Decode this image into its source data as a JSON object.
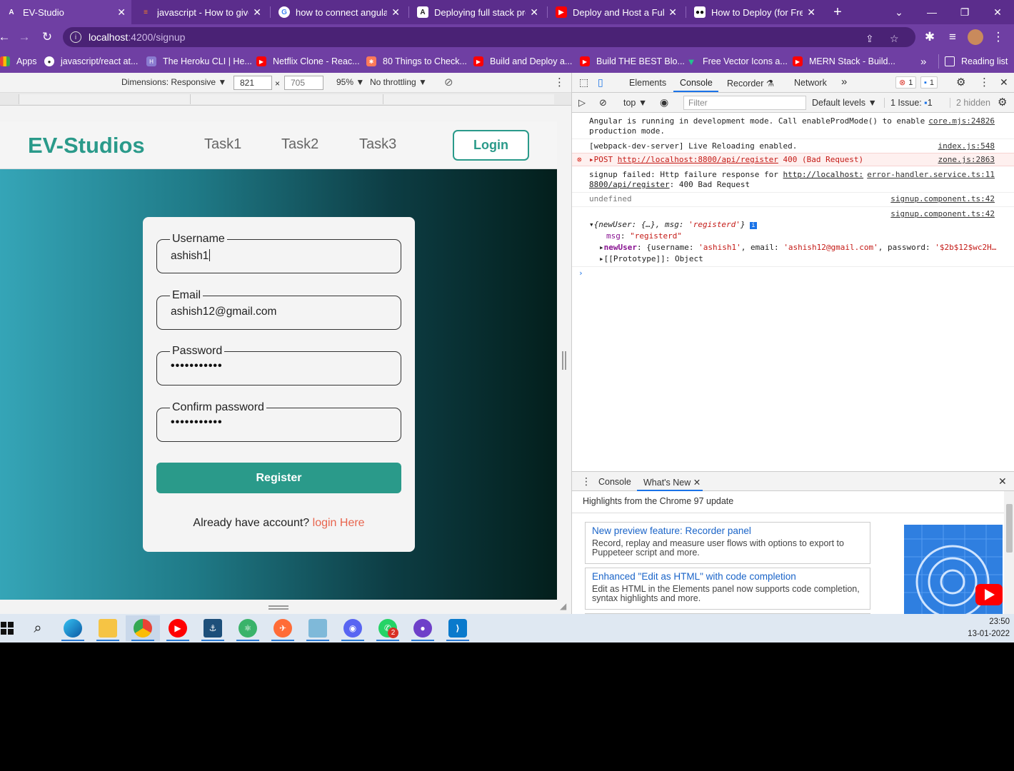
{
  "browser": {
    "tabs": [
      {
        "title": "EV-Studio",
        "icon": "angular-icon",
        "color": "#ffffff"
      },
      {
        "title": "javascript - How to give",
        "icon": "stackoverflow-icon",
        "color": "#f48024"
      },
      {
        "title": "how to connect angular",
        "icon": "google-icon",
        "color": "#4285f4"
      },
      {
        "title": "Deploying full stack proj",
        "icon": "angular-icon",
        "color": "#222222"
      },
      {
        "title": "Deploy and Host a Fullst",
        "icon": "youtube-icon",
        "color": "#ff0000"
      },
      {
        "title": "How to Deploy (for Free",
        "icon": "medium-icon",
        "color": "#000000"
      }
    ],
    "new_tab": "+",
    "url_host": "localhost",
    "url_path": ":4200/signup",
    "bookmarks": [
      {
        "label": "Apps",
        "icon": "apps-icon",
        "color": "#e94235"
      },
      {
        "label": "javascript/react at...",
        "icon": "github-icon",
        "color": "#222222"
      },
      {
        "label": "The Heroku CLI | He...",
        "icon": "heroku-icon",
        "color": "#8a7bd0"
      },
      {
        "label": "Netflix Clone - Reac...",
        "icon": "youtube-icon",
        "color": "#ff0000"
      },
      {
        "label": "80 Things to Check...",
        "icon": "hubspot-icon",
        "color": "#ff7a59"
      },
      {
        "label": "Build and Deploy a...",
        "icon": "youtube-icon",
        "color": "#ff0000"
      },
      {
        "label": "Build THE BEST Blo...",
        "icon": "youtube-icon",
        "color": "#ff0000"
      },
      {
        "label": "Free Vector Icons a...",
        "icon": "vector-icon",
        "color": "#22c38e"
      },
      {
        "label": "MERN Stack - Build...",
        "icon": "youtube-icon",
        "color": "#ff0000"
      }
    ],
    "more_bookmarks": "»",
    "reading_list": "Reading list"
  },
  "device_toolbar": {
    "dimensions_label": "Dimensions: Responsive",
    "width": "821",
    "times": "×",
    "height": "705",
    "zoom": "95%",
    "throttle": "No throttling"
  },
  "app": {
    "brand": "EV-Studios",
    "nav": [
      "Task1",
      "Task2",
      "Task3"
    ],
    "login_button": "Login",
    "form": {
      "username_label": "Username",
      "username_value": "ashish1",
      "email_label": "Email",
      "email_value": "ashish12@gmail.com",
      "password_label": "Password",
      "password_value": "•••••••••••",
      "confirm_label": "Confirm password",
      "confirm_value": "•••••••••••",
      "register_button": "Register",
      "already_text": "Already have account?",
      "login_link": "login Here"
    }
  },
  "devtools": {
    "tabs": [
      "Elements",
      "Console",
      "Recorder",
      "Network"
    ],
    "more": "»",
    "errors_badge": "1",
    "messages_badge": "1",
    "context": "top",
    "filter_placeholder": "Filter",
    "levels": "Default levels",
    "issues": "1 Issue:",
    "issues_count": "1",
    "hidden": "2 hidden",
    "logs": {
      "angular_line1": "Angular is running in development mode. Call enableProdMode() to enable",
      "angular_src": "core.mjs:24826",
      "angular_line2": "production mode.",
      "wds": "[webpack-dev-server] Live Reloading enabled.",
      "wds_src": "index.js:548",
      "err_prefix": "POST",
      "err_url": "http://localhost:8800/api/register",
      "err_status": "400 (Bad Request)",
      "err_src": "zone.js:2863",
      "signup_prefix": "signup failed: Http failure response for",
      "signup_url1": "http://localhost:",
      "signup_src": "error-handler.service.ts:11",
      "signup_url2": "8800/api/register",
      "signup_suffix": ": 400 Bad Request",
      "undefined": "undefined",
      "undef_src": "signup.component.ts:42",
      "obj_src": "signup.component.ts:42",
      "obj_summary_a": "{newUser: {…}, msg: ",
      "obj_summary_b": "'registerd'",
      "obj_summary_c": "}",
      "msg_key": "msg",
      "msg_val": "\"registerd\"",
      "newuser_key": "newUser",
      "newuser_a": "{username: ",
      "newuser_b": "'ashish1'",
      "newuser_c": ", email: ",
      "newuser_d": "'ashish12@gmail.com'",
      "newuser_e": ", password: ",
      "newuser_f": "'$2b$12$wc2H…",
      "proto_key": "[[Prototype]]",
      "proto_val": "Object"
    },
    "drawer_tabs": [
      "Console",
      "What's New"
    ],
    "whats_new_heading": "Highlights from the Chrome 97 update",
    "cards": [
      {
        "title": "New preview feature: Recorder panel",
        "desc": "Record, replay and measure user flows with options to export to Puppeteer script and more."
      },
      {
        "title": "Enhanced \"Edit as HTML\" with code completion",
        "desc": "Edit as HTML in the Elements panel now supports code completion, syntax highlights and more."
      }
    ]
  },
  "taskbar": {
    "time": "23:50",
    "date": "13-01-2022",
    "notification_count": "2"
  }
}
